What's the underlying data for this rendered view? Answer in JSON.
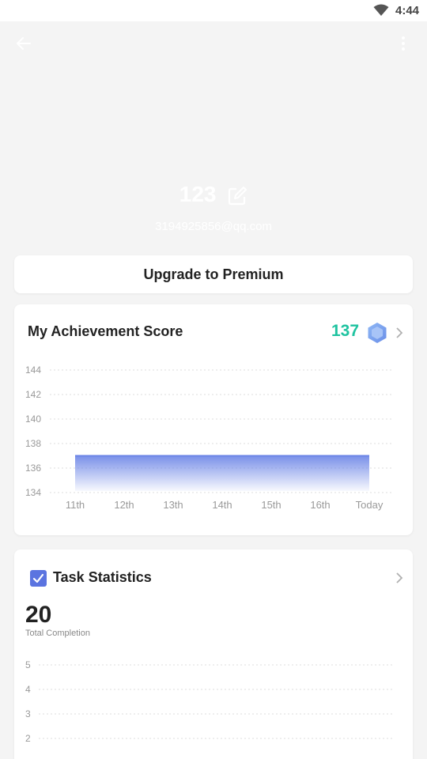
{
  "status_bar": {
    "time": "4:44"
  },
  "profile": {
    "name": "123",
    "email": "3194925856@qq.com"
  },
  "premium": {
    "label": "Upgrade to Premium"
  },
  "achievement": {
    "title": "My Achievement Score",
    "score": "137"
  },
  "tasks": {
    "title": "Task Statistics",
    "total": "20",
    "total_label": "Total Completion"
  },
  "chart_data": [
    {
      "type": "area",
      "categories": [
        "11th",
        "12th",
        "13th",
        "14th",
        "15th",
        "16th",
        "Today"
      ],
      "values": [
        137,
        137,
        137,
        137,
        137,
        137,
        137
      ],
      "y_ticks": [
        "144",
        "142",
        "140",
        "138",
        "136",
        "134"
      ],
      "ylim": [
        134,
        144
      ],
      "grid": true,
      "color": "#6b84e6"
    },
    {
      "type": "line",
      "y_ticks": [
        "5",
        "4",
        "3",
        "2"
      ],
      "grid": true
    }
  ]
}
